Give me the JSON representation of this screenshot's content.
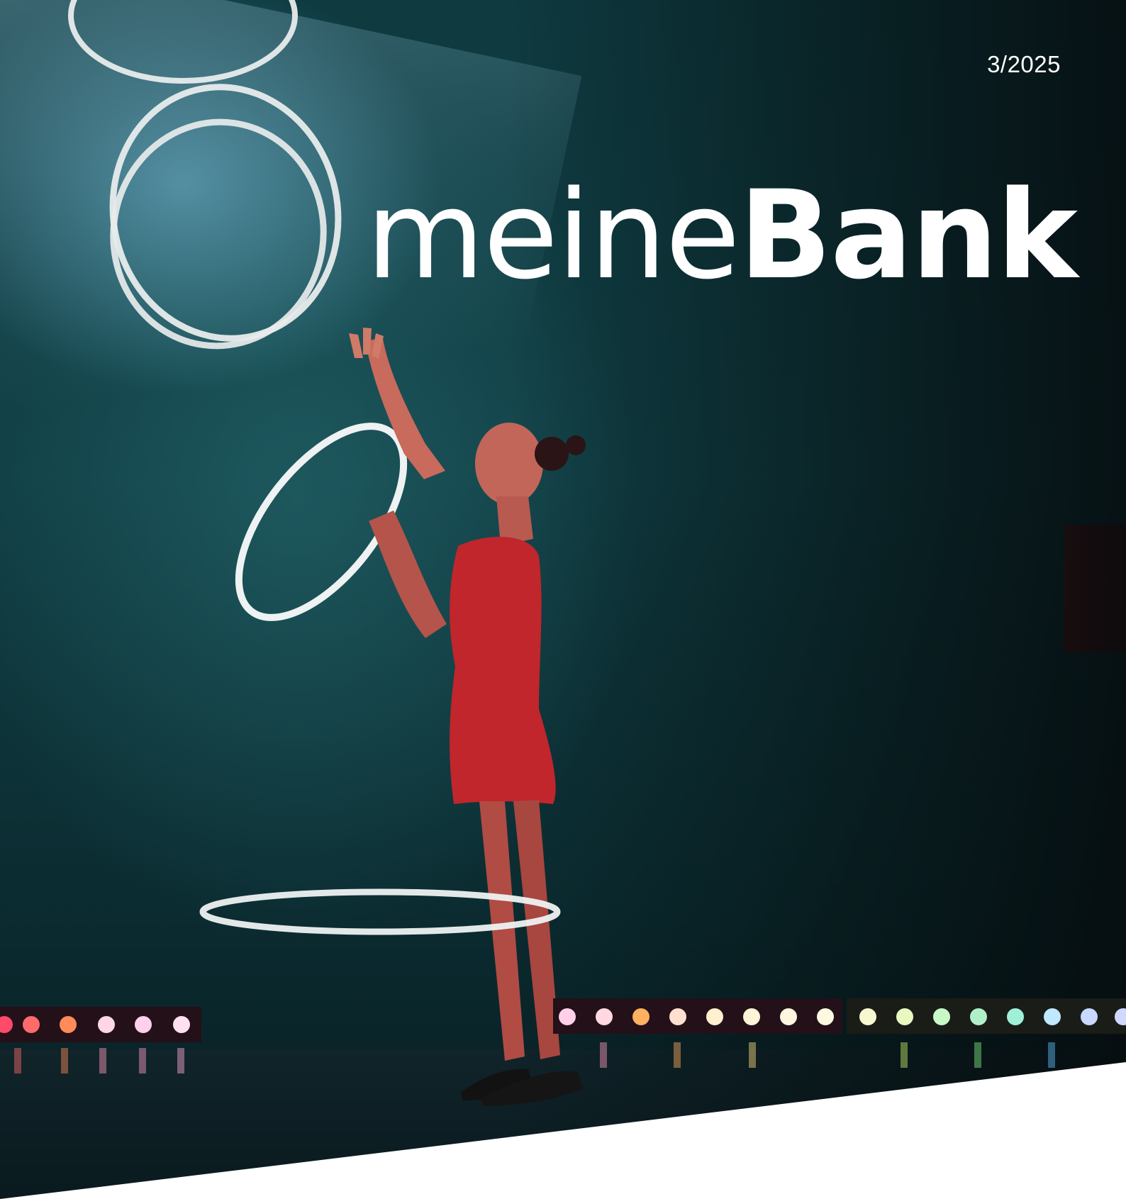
{
  "cover": {
    "issue": "3/2025",
    "brand": {
      "prefix": "meine",
      "suffix": "Bank"
    }
  },
  "colors": {
    "background": "#0e3a40",
    "text": "#ffffff",
    "dress": "#c0262c",
    "hoop": "#e8ecec"
  },
  "stage_lights": [
    "#ff4a6a",
    "#ff6a6a",
    "#ff8a5a",
    "#ffb040",
    "#ffd060",
    "#ffe070",
    "#f8f070",
    "#c8f070",
    "#80f080",
    "#50e0b0",
    "#50c0f0",
    "#6080ff"
  ]
}
